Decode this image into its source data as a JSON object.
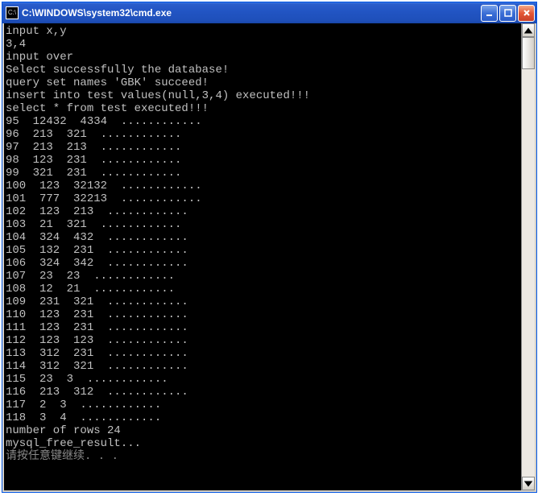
{
  "window": {
    "icon_label": "C:\\",
    "title": "C:\\WINDOWS\\system32\\cmd.exe"
  },
  "controls": {
    "minimize": "minimize",
    "maximize": "maximize",
    "close": "close"
  },
  "scrollbar": {
    "up": "scroll-up",
    "down": "scroll-down",
    "thumb": "scroll-thumb"
  },
  "console": {
    "header_lines": [
      "input x,y",
      "3,4",
      "input over",
      "Select successfully the database!",
      "query set names 'GBK' succeed!",
      "insert into test values(null,3,4) executed!!!",
      "select * from test executed!!!"
    ],
    "rows": [
      {
        "a": "95",
        "b": "12432",
        "c": "4334"
      },
      {
        "a": "96",
        "b": "213",
        "c": "321"
      },
      {
        "a": "97",
        "b": "213",
        "c": "213"
      },
      {
        "a": "98",
        "b": "123",
        "c": "231"
      },
      {
        "a": "99",
        "b": "321",
        "c": "231"
      },
      {
        "a": "100",
        "b": "123",
        "c": "32132"
      },
      {
        "a": "101",
        "b": "777",
        "c": "32213"
      },
      {
        "a": "102",
        "b": "123",
        "c": "213"
      },
      {
        "a": "103",
        "b": "21",
        "c": "321"
      },
      {
        "a": "104",
        "b": "324",
        "c": "432"
      },
      {
        "a": "105",
        "b": "132",
        "c": "231"
      },
      {
        "a": "106",
        "b": "324",
        "c": "342"
      },
      {
        "a": "107",
        "b": "23",
        "c": "23"
      },
      {
        "a": "108",
        "b": "12",
        "c": "21"
      },
      {
        "a": "109",
        "b": "231",
        "c": "321"
      },
      {
        "a": "110",
        "b": "123",
        "c": "231"
      },
      {
        "a": "111",
        "b": "123",
        "c": "231"
      },
      {
        "a": "112",
        "b": "123",
        "c": "123"
      },
      {
        "a": "113",
        "b": "312",
        "c": "231"
      },
      {
        "a": "114",
        "b": "312",
        "c": "321"
      },
      {
        "a": "115",
        "b": "23",
        "c": "3"
      },
      {
        "a": "116",
        "b": "213",
        "c": "312"
      },
      {
        "a": "117",
        "b": "2",
        "c": "3"
      },
      {
        "a": "118",
        "b": "3",
        "c": "4"
      }
    ],
    "row_suffix": "............",
    "footer_lines": [
      "number of rows 24",
      "mysql_free_result..."
    ],
    "prompt_line": "请按任意键继续. . ."
  }
}
